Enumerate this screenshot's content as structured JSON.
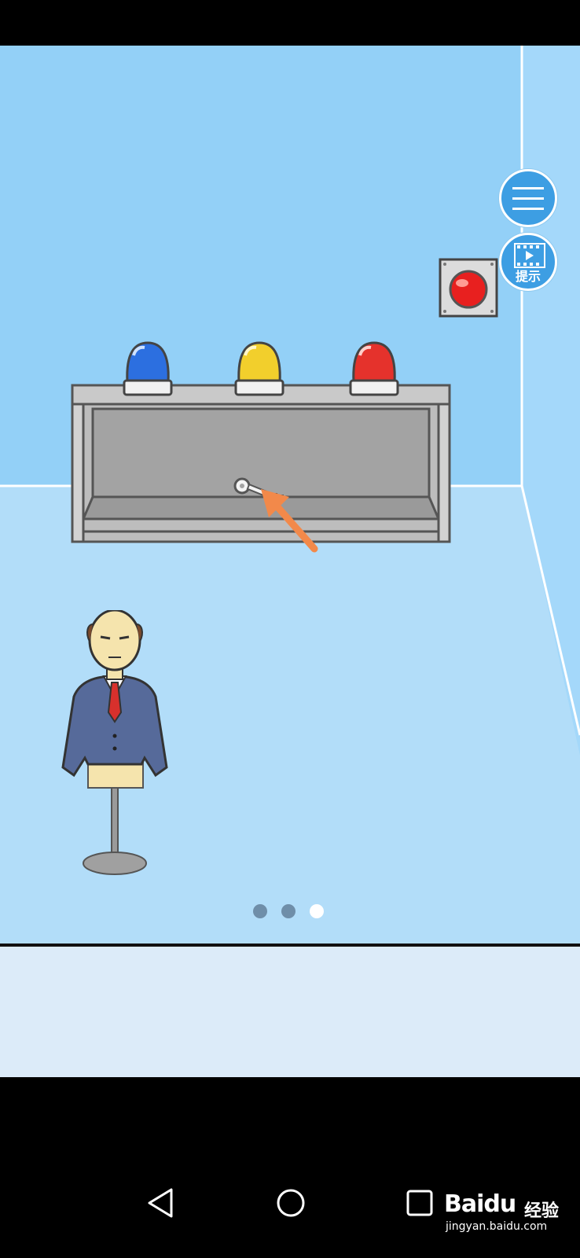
{
  "hud": {
    "menu_icon": "hamburger-menu-icon",
    "hint_icon": "video-play-icon",
    "hint_label": "提示"
  },
  "scene": {
    "sirens": [
      {
        "color": "blue",
        "hex": "#2c6fe0"
      },
      {
        "color": "yellow",
        "hex": "#f2cf2c"
      },
      {
        "color": "red",
        "hex": "#e5322c"
      }
    ],
    "wall_button_color": "#e8201f",
    "hidden_item": "key-icon",
    "pointer": "orange-arrow-icon",
    "character": "suit-mannequin"
  },
  "pagination": {
    "count": 3,
    "active_index": 2
  },
  "nav": {
    "back": "back-triangle-icon",
    "home": "home-circle-icon",
    "recent": "recent-square-icon"
  },
  "watermark": {
    "brand": "Baidu",
    "sub": "经验",
    "url": "jingyan.baidu.com"
  },
  "colors": {
    "wall": "#93d0f7",
    "floor": "#b2ddf9",
    "shelf": "#c6c6c6",
    "shelf_inner": "#a5a5a5"
  }
}
